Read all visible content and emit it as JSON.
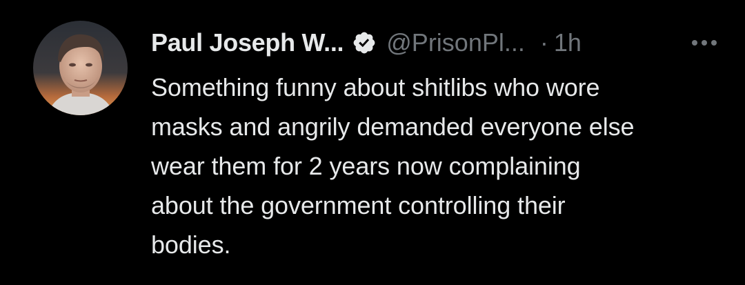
{
  "tweet": {
    "author": {
      "display_name": "Paul Joseph W...",
      "handle": "@PrisonPl...",
      "verified": true,
      "verified_icon": "verified-badge-icon",
      "avatar_icon": "avatar"
    },
    "separator": "·",
    "timestamp": "1h",
    "more_icon": "more-options-icon",
    "text": "Something funny about shitlibs who wore\nmasks and angrily demanded everyone else\nwear them for 2 years now complaining\nabout the government controlling their\nbodies."
  },
  "colors": {
    "background": "#000000",
    "primary_text": "#e7e9ea",
    "secondary_text": "#71767b"
  }
}
